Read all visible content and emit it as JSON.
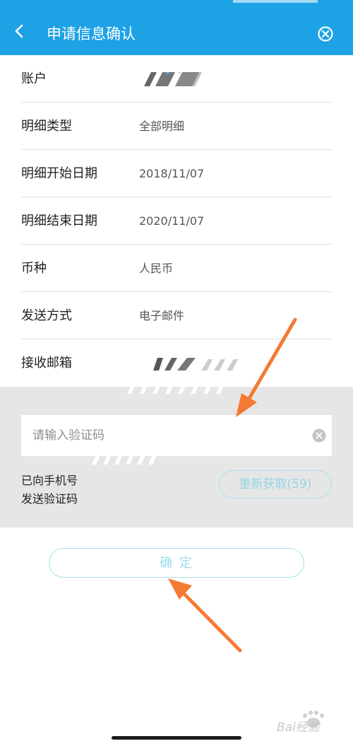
{
  "header": {
    "title": "申请信息确认",
    "back_icon": "chevron-left-icon",
    "close_icon": "close-circle-icon",
    "background_color": "#1ea2e6"
  },
  "rows": [
    {
      "label": "账户",
      "value": ""
    },
    {
      "label": "明细类型",
      "value": "全部明细"
    },
    {
      "label": "明细开始日期",
      "value": "2018/11/07"
    },
    {
      "label": "明细结束日期",
      "value": "2020/11/07"
    },
    {
      "label": "币种",
      "value": "人民币"
    },
    {
      "label": "发送方式",
      "value": "电子邮件"
    },
    {
      "label": "接收邮箱",
      "value": ""
    }
  ],
  "verify": {
    "placeholder": "请输入验证码",
    "note_line1": "已向手机号",
    "note_line2": "发送验证码",
    "resend_label": "重新获取(59)",
    "clear_icon": "clear-circle-icon"
  },
  "confirm_label": "确 定",
  "annotation_color": "#f47a33",
  "watermark": "Bai经验"
}
